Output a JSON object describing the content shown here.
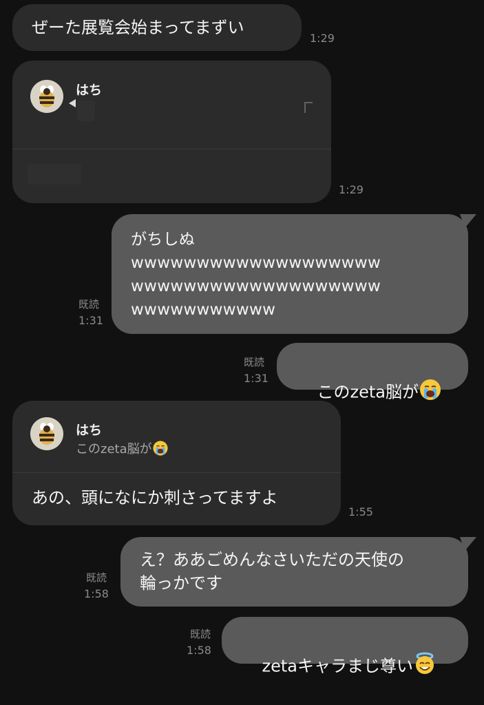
{
  "messages": [
    {
      "text": "ぜーた展覧会始まってまずい",
      "time": "1:29"
    },
    {
      "quote_name": "はち",
      "time": "1:29"
    },
    {
      "text": "がちしぬ\nwwwwwwwwwwwwwwwwwww\nwwwwwwwwwwwwwwwwwww\nwwwwwwwwwww",
      "read": "既読",
      "time": "1:31"
    },
    {
      "text": "このzeta脳が",
      "emoji": "loudly-crying-face",
      "read": "既読",
      "time": "1:31"
    },
    {
      "quote_name": "はち",
      "quote_text": "このzeta脳が",
      "quote_emoji": "loudly-crying-face",
      "text": "あの、頭になにか刺さってますよ",
      "time": "1:55"
    },
    {
      "text": "え？ああごめんなさいただの天使の\n輪っかです",
      "read": "既読",
      "time": "1:58"
    },
    {
      "text": "zetaキャラまじ尊い",
      "emoji": "smiling-face-with-halo",
      "read": "既読",
      "time": "1:58"
    }
  ]
}
